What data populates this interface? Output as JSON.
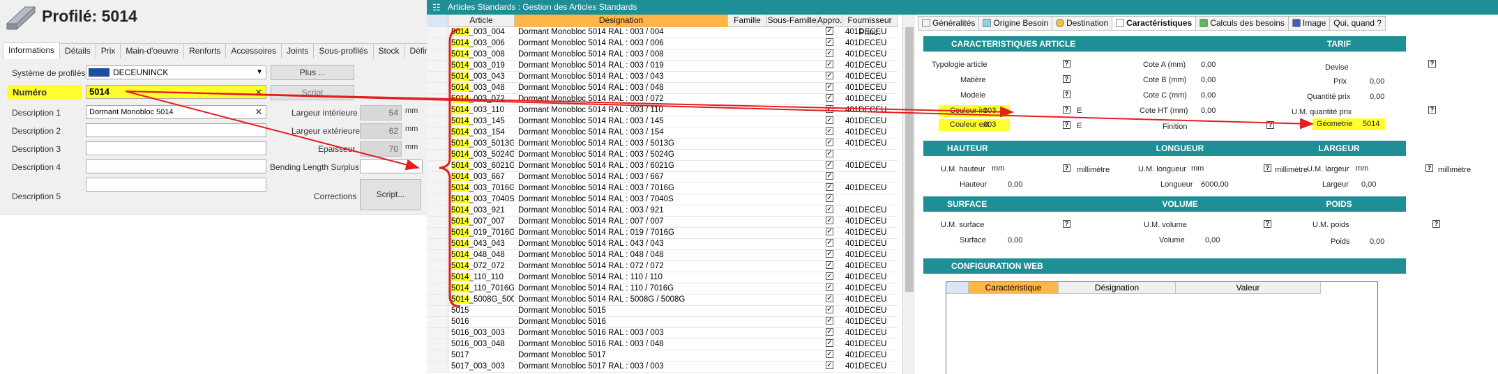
{
  "left": {
    "title": "Profilé: 5014",
    "tabs": [
      "Informations",
      "Détails",
      "Prix",
      "Main-d'oeuvre",
      "Renforts",
      "Accessoires",
      "Joints",
      "Sous-profilés",
      "Stock",
      "Défini par l'utilis"
    ],
    "systeme_label": "Système de profilés",
    "systeme_value": "DECEUNINCK",
    "plus_button": "Plus ...",
    "numero_label": "Numéro",
    "numero_value": "5014",
    "script_button": "Script",
    "desc1_label": "Description 1",
    "desc1_value": "Dormant Monobloc 5014",
    "desc2_label": "Description 2",
    "desc3_label": "Description 3",
    "desc4_label": "Description 4",
    "desc5_label": "Description 5",
    "largeur_int_label": "Largeur intérieure",
    "largeur_int_value": "54",
    "largeur_ext_label": "Largeur extérieure",
    "largeur_ext_value": "62",
    "epaisseur_label": "Epaisseur",
    "epaisseur_value": "70",
    "unit_mm": "mm",
    "bending_label": "Bending Length Surplus",
    "corrections_label": "Corrections",
    "script2_button": "Script..."
  },
  "mid": {
    "title": "Articles Standards : Gestion des Articles Standards",
    "columns": [
      "Article",
      "Désignation",
      "Famille",
      "Sous-Famille",
      "Appro.",
      "Fournisseur Princ."
    ],
    "rows": [
      {
        "p": "5014",
        "s": "_003_004",
        "d": "Dormant Monobloc 5014 RAL : 003 / 004",
        "f": "401DECEU"
      },
      {
        "p": "5014",
        "s": "_003_006",
        "d": "Dormant Monobloc 5014 RAL : 003 / 006",
        "f": "401DECEU"
      },
      {
        "p": "5014",
        "s": "_003_008",
        "d": "Dormant Monobloc 5014 RAL : 003 / 008",
        "f": "401DECEU"
      },
      {
        "p": "5014",
        "s": "_003_019",
        "d": "Dormant Monobloc 5014 RAL : 003 / 019",
        "f": "401DECEU"
      },
      {
        "p": "5014",
        "s": "_003_043",
        "d": "Dormant Monobloc 5014 RAL : 003 / 043",
        "f": "401DECEU"
      },
      {
        "p": "5014",
        "s": "_003_048",
        "d": "Dormant Monobloc 5014 RAL : 003 / 048",
        "f": "401DECEU"
      },
      {
        "p": "5014",
        "s": "_003_072",
        "d": "Dormant Monobloc 5014 RAL : 003 / 072",
        "f": "401DECEU"
      },
      {
        "p": "5014",
        "s": "_003_110",
        "d": "Dormant Monobloc 5014 RAL : 003 / 110",
        "f": "401DECEU"
      },
      {
        "p": "5014",
        "s": "_003_145",
        "d": "Dormant Monobloc 5014 RAL : 003 / 145",
        "f": "401DECEU"
      },
      {
        "p": "5014",
        "s": "_003_154",
        "d": "Dormant Monobloc 5014 RAL : 003 / 154",
        "f": "401DECEU"
      },
      {
        "p": "5014",
        "s": "_003_5013G",
        "d": "Dormant Monobloc 5014 RAL : 003 / 5013G",
        "f": "401DECEU"
      },
      {
        "p": "5014",
        "s": "_003_5024G",
        "d": "Dormant Monobloc 5014 RAL : 003 / 5024G",
        "f": ""
      },
      {
        "p": "5014",
        "s": "_003_6021G",
        "d": "Dormant Monobloc 5014 RAL : 003 / 6021G",
        "f": "401DECEU"
      },
      {
        "p": "5014",
        "s": "_003_667",
        "d": "Dormant Monobloc 5014 RAL : 003 / 667",
        "f": ""
      },
      {
        "p": "5014",
        "s": "_003_7016G",
        "d": "Dormant Monobloc 5014 RAL : 003 / 7016G",
        "f": "401DECEU"
      },
      {
        "p": "5014",
        "s": "_003_7040S",
        "d": "Dormant Monobloc 5014 RAL : 003 / 7040S",
        "f": ""
      },
      {
        "p": "5014",
        "s": "_003_921",
        "d": "Dormant Monobloc 5014 RAL : 003 / 921",
        "f": "401DECEU"
      },
      {
        "p": "5014",
        "s": "_007_007",
        "d": "Dormant Monobloc 5014 RAL : 007 / 007",
        "f": "401DECEU"
      },
      {
        "p": "5014",
        "s": "_019_7016G",
        "d": "Dormant Monobloc 5014 RAL : 019 / 7016G",
        "f": "401DECEU"
      },
      {
        "p": "5014",
        "s": "_043_043",
        "d": "Dormant Monobloc 5014 RAL : 043 / 043",
        "f": "401DECEU"
      },
      {
        "p": "5014",
        "s": "_048_048",
        "d": "Dormant Monobloc 5014 RAL : 048 / 048",
        "f": "401DECEU"
      },
      {
        "p": "5014",
        "s": "_072_072",
        "d": "Dormant Monobloc 5014 RAL : 072 / 072",
        "f": "401DECEU"
      },
      {
        "p": "5014",
        "s": "_110_110",
        "d": "Dormant Monobloc 5014 RAL : 110 / 110",
        "f": "401DECEU"
      },
      {
        "p": "5014",
        "s": "_110_7016G",
        "d": "Dormant Monobloc 5014 RAL : 110 / 7016G",
        "f": "401DECEU"
      },
      {
        "p": "5014",
        "s": "_5008G_5008G",
        "d": "Dormant Monobloc 5014 RAL : 5008G / 5008G",
        "f": "401DECEU"
      },
      {
        "p": "",
        "s": "5015",
        "d": "Dormant Monobloc 5015",
        "f": "401DECEU"
      },
      {
        "p": "",
        "s": "5016",
        "d": "Dormant Monobloc 5016",
        "f": "401DECEU"
      },
      {
        "p": "",
        "s": "5016_003_003",
        "d": "Dormant Monobloc 5016 RAL : 003 / 003",
        "f": "401DECEU"
      },
      {
        "p": "",
        "s": "5016_003_048",
        "d": "Dormant Monobloc 5016 RAL : 003 / 048",
        "f": "401DECEU"
      },
      {
        "p": "",
        "s": "5017",
        "d": "Dormant Monobloc 5017",
        "f": "401DECEU"
      },
      {
        "p": "",
        "s": "5017_003_003",
        "d": "Dormant Monobloc 5017 RAL : 003 / 003",
        "f": "401DECEU"
      }
    ]
  },
  "right": {
    "tabs": [
      "Généralités",
      "Origine Besoin",
      "Destination",
      "Caractéristiques",
      "Calculs des besoins",
      "Image",
      "Qui, quand ?"
    ],
    "sec_caract": "CARACTERISTIQUES ARTICLE",
    "sec_tarif": "TARIF",
    "typologie": "Typologie article",
    "matiere": "Matière",
    "modele": "Modele",
    "couleur_int_label": "Couleur int",
    "couleur_int_value": "003",
    "couleur_ext_label": "Couleur ext",
    "couleur_ext_value": "003",
    "e_label": "E",
    "cote_a": "Cote A (mm)",
    "cote_b": "Cote B (mm)",
    "cote_c": "Cote C (mm)",
    "cote_ht": "Cote HT (mm)",
    "zero": "0,00",
    "finition": "Finition",
    "devise": "Devise",
    "prix": "Prix",
    "quantite_prix": "Quantité prix",
    "um_quantite_prix": "U.M. quantité prix",
    "geometrie_label": "Géometrie",
    "geometrie_value": "5014",
    "sec_hauteur": "HAUTEUR",
    "sec_longueur": "LONGUEUR",
    "sec_largeur": "LARGEUR",
    "um_hauteur": "U.M. hauteur",
    "um_longueur": "U.M. longueur",
    "um_largeur": "U.M. largeur",
    "mm": "mm",
    "millimetre": "millimètre",
    "hauteur": "Hauteur",
    "longueur": "Longueur",
    "longueur_value": "6000,00",
    "largeur": "Largeur",
    "sec_surface": "SURFACE",
    "sec_volume": "VOLUME",
    "sec_poids": "POIDS",
    "um_surface": "U.M. surface",
    "um_volume": "U.M. volume",
    "um_poids": "U.M. poids",
    "surface": "Surface",
    "volume": "Volume",
    "poids": "Poids",
    "sec_config": "CONFIGURATION WEB",
    "cfg_cols": [
      "Caractéristique",
      "Désignation",
      "Valeur"
    ]
  }
}
